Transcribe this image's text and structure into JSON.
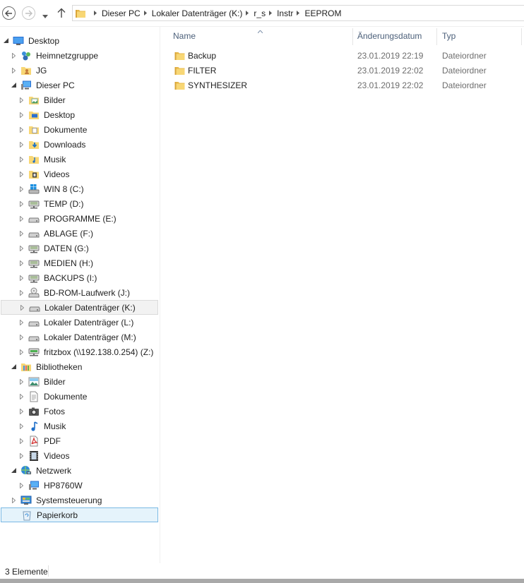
{
  "address": {
    "crumbs": [
      "Dieser PC",
      "Lokaler Datenträger (K:)",
      "r_s",
      "Instr",
      "EEPROM"
    ]
  },
  "columns": {
    "name": "Name",
    "date": "Änderungsdatum",
    "type": "Typ"
  },
  "files": [
    {
      "name": "Backup",
      "date": "23.01.2019 22:19",
      "type": "Dateiordner"
    },
    {
      "name": "FILTER",
      "date": "23.01.2019 22:02",
      "type": "Dateiordner"
    },
    {
      "name": "SYNTHESIZER",
      "date": "23.01.2019 22:02",
      "type": "Dateiordner"
    }
  ],
  "tree": [
    {
      "label": "Desktop",
      "icon": "desktop-icon",
      "expander": "expanded"
    },
    {
      "label": "Heimnetzgruppe",
      "icon": "homegroup-icon",
      "expander": "collapsed"
    },
    {
      "label": "JG",
      "icon": "user-folder-icon",
      "expander": "collapsed"
    },
    {
      "label": "Dieser PC",
      "icon": "computer-icon",
      "expander": "expanded"
    },
    {
      "label": "Bilder",
      "icon": "pictures-folder-icon",
      "expander": "collapsed"
    },
    {
      "label": "Desktop",
      "icon": "desktop-folder-icon",
      "expander": "collapsed"
    },
    {
      "label": "Dokumente",
      "icon": "documents-folder-icon",
      "expander": "collapsed"
    },
    {
      "label": "Downloads",
      "icon": "downloads-folder-icon",
      "expander": "collapsed"
    },
    {
      "label": "Musik",
      "icon": "music-folder-icon",
      "expander": "collapsed"
    },
    {
      "label": "Videos",
      "icon": "videos-folder-icon",
      "expander": "collapsed"
    },
    {
      "label": "WIN 8 (C:)",
      "icon": "windows-drive-icon",
      "expander": "collapsed"
    },
    {
      "label": "TEMP (D:)",
      "icon": "network-drive-icon",
      "expander": "collapsed"
    },
    {
      "label": "PROGRAMME (E:)",
      "icon": "hard-drive-icon",
      "expander": "collapsed"
    },
    {
      "label": "ABLAGE (F:)",
      "icon": "hard-drive-icon",
      "expander": "collapsed"
    },
    {
      "label": "DATEN (G:)",
      "icon": "network-drive-icon",
      "expander": "collapsed"
    },
    {
      "label": "MEDIEN (H:)",
      "icon": "network-drive-icon",
      "expander": "collapsed"
    },
    {
      "label": "BACKUPS (I:)",
      "icon": "network-drive-icon",
      "expander": "collapsed"
    },
    {
      "label": "BD-ROM-Laufwerk (J:)",
      "icon": "optical-drive-icon",
      "expander": "collapsed"
    },
    {
      "label": "Lokaler Datenträger (K:)",
      "icon": "hard-drive-icon",
      "expander": "collapsed",
      "state": "hover"
    },
    {
      "label": "Lokaler Datenträger (L:)",
      "icon": "hard-drive-icon",
      "expander": "collapsed"
    },
    {
      "label": "Lokaler Datenträger (M:)",
      "icon": "hard-drive-icon",
      "expander": "collapsed"
    },
    {
      "label": "fritzbox (\\\\192.138.0.254) (Z:)",
      "icon": "network-share-icon",
      "expander": "collapsed"
    },
    {
      "label": "Bibliotheken",
      "icon": "libraries-icon",
      "expander": "expanded"
    },
    {
      "label": "Bilder",
      "icon": "pictures-library-icon",
      "expander": "collapsed"
    },
    {
      "label": "Dokumente",
      "icon": "documents-library-icon",
      "expander": "collapsed"
    },
    {
      "label": "Fotos",
      "icon": "camera-library-icon",
      "expander": "collapsed"
    },
    {
      "label": "Musik",
      "icon": "music-library-icon",
      "expander": "collapsed"
    },
    {
      "label": "PDF",
      "icon": "pdf-library-icon",
      "expander": "collapsed"
    },
    {
      "label": "Videos",
      "icon": "videos-library-icon",
      "expander": "collapsed"
    },
    {
      "label": "Netzwerk",
      "icon": "network-icon",
      "expander": "expanded"
    },
    {
      "label": "HP8760W",
      "icon": "network-computer-icon",
      "expander": "collapsed"
    },
    {
      "label": "Systemsteuerung",
      "icon": "control-panel-icon",
      "expander": "collapsed"
    },
    {
      "label": "Papierkorb",
      "icon": "recycle-bin-icon",
      "expander": "none",
      "state": "selected"
    }
  ],
  "status": {
    "item_count": "3 Elemente"
  },
  "colors": {
    "folder": "#f8d775",
    "selection_bg": "#e5f3fb",
    "selection_border": "#7ab9e4",
    "header_text": "#4c607a"
  }
}
